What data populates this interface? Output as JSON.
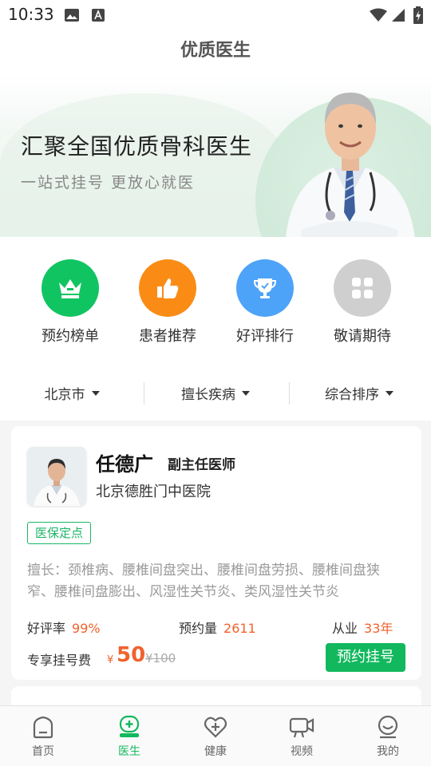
{
  "status_bar": {
    "time": "10:33"
  },
  "header": {
    "title": "优质医生"
  },
  "banner": {
    "title": "汇聚全国优质骨科医生",
    "subtitle": "一站式挂号 更放心就医"
  },
  "categories": [
    {
      "label": "预约榜单",
      "icon": "crown-icon",
      "color": "#11c462"
    },
    {
      "label": "患者推荐",
      "icon": "thumbs-up-icon",
      "color": "#fa8c16"
    },
    {
      "label": "好评排行",
      "icon": "trophy-icon",
      "color": "#4da3f7"
    },
    {
      "label": "敬请期待",
      "icon": "grid-icon",
      "color": "#cfcfcf"
    }
  ],
  "filters": [
    {
      "label": "北京市"
    },
    {
      "label": "擅长疾病"
    },
    {
      "label": "综合排序"
    }
  ],
  "doctor_card": {
    "name": "任德广",
    "title": "副主任医师",
    "hospital": "北京德胜门中医院",
    "badge": "医保定点",
    "specialty": "擅长：颈椎病、腰椎间盘突出、腰椎间盘劳损、腰椎间盘狭窄、腰椎间盘膨出、风湿性关节炎、类风湿性关节炎",
    "rating_label": "好评率",
    "rating_value": "99%",
    "appointments_label": "预约量",
    "appointments_value": "2611",
    "experience_label": "从业",
    "experience_value": "33年",
    "fee_label": "专享挂号费",
    "fee_currency": "¥",
    "fee_value": "50",
    "fee_original": "¥100",
    "book_button": "预约挂号"
  },
  "bottom_nav": [
    {
      "label": "首页",
      "icon": "home-icon",
      "active": false
    },
    {
      "label": "医生",
      "icon": "doctor-icon",
      "active": true
    },
    {
      "label": "健康",
      "icon": "health-heart-icon",
      "active": false
    },
    {
      "label": "视频",
      "icon": "video-icon",
      "active": false
    },
    {
      "label": "我的",
      "icon": "profile-icon",
      "active": false
    }
  ],
  "colors": {
    "accent": "#12b85d",
    "price": "#f0622d"
  }
}
